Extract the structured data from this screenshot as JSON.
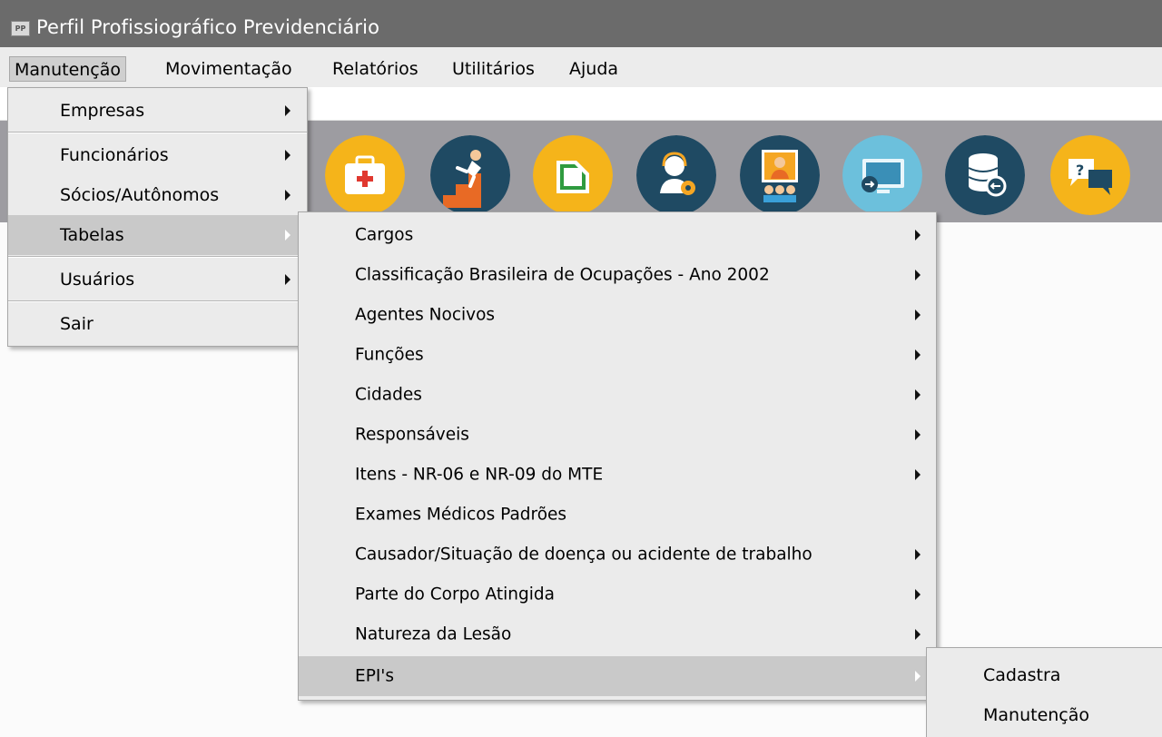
{
  "window": {
    "title": "Perfil Profissiográfico Previdenciário",
    "icon_text": "PP"
  },
  "menubar": {
    "items": [
      {
        "label": "Manutenção"
      },
      {
        "label": "Movimentação"
      },
      {
        "label": "Relatórios"
      },
      {
        "label": "Utilitários"
      },
      {
        "label": "Ajuda"
      }
    ]
  },
  "toolbar": {
    "buttons": [
      {
        "icon": "first-aid-kit-icon"
      },
      {
        "icon": "fall-accident-icon"
      },
      {
        "icon": "document-icon"
      },
      {
        "icon": "support-agent-icon"
      },
      {
        "icon": "team-presentation-icon"
      },
      {
        "icon": "monitor-export-icon"
      },
      {
        "icon": "database-import-icon"
      },
      {
        "icon": "help-chat-icon"
      }
    ]
  },
  "menu_manutencao": {
    "items": [
      {
        "label": "Empresas",
        "submenu": true
      },
      {
        "label": "Funcionários",
        "submenu": true
      },
      {
        "label": "Sócios/Autônomos",
        "submenu": true
      },
      {
        "label": "Tabelas",
        "submenu": true,
        "highlighted": true
      },
      {
        "label": "Usuários",
        "submenu": true
      },
      {
        "label": "Sair",
        "submenu": false
      }
    ]
  },
  "menu_tabelas": {
    "items": [
      {
        "label": "Cargos",
        "submenu": true
      },
      {
        "label": "Classificação Brasileira de Ocupações - Ano 2002",
        "submenu": true
      },
      {
        "label": "Agentes Nocivos",
        "submenu": true
      },
      {
        "label": "Funções",
        "submenu": true
      },
      {
        "label": "Cidades",
        "submenu": true
      },
      {
        "label": "Responsáveis",
        "submenu": true
      },
      {
        "label": "Itens - NR-06 e NR-09 do MTE",
        "submenu": true
      },
      {
        "label": "Exames Médicos Padrões",
        "submenu": false
      },
      {
        "label": "Causador/Situação de doença ou acidente de trabalho",
        "submenu": true
      },
      {
        "label": "Parte do Corpo Atingida",
        "submenu": true
      },
      {
        "label": "Natureza da Lesão",
        "submenu": true
      },
      {
        "label": "EPI's",
        "submenu": true,
        "highlighted": true
      }
    ]
  },
  "menu_epis": {
    "items": [
      {
        "label": "Cadastra"
      },
      {
        "label": "Manutenção"
      }
    ]
  },
  "colors": {
    "titlebar": "#6b6b6b",
    "toolbar": "#9d9ca1",
    "menu_bg": "#ebebeb",
    "menu_highlight": "#c9c9c9"
  }
}
